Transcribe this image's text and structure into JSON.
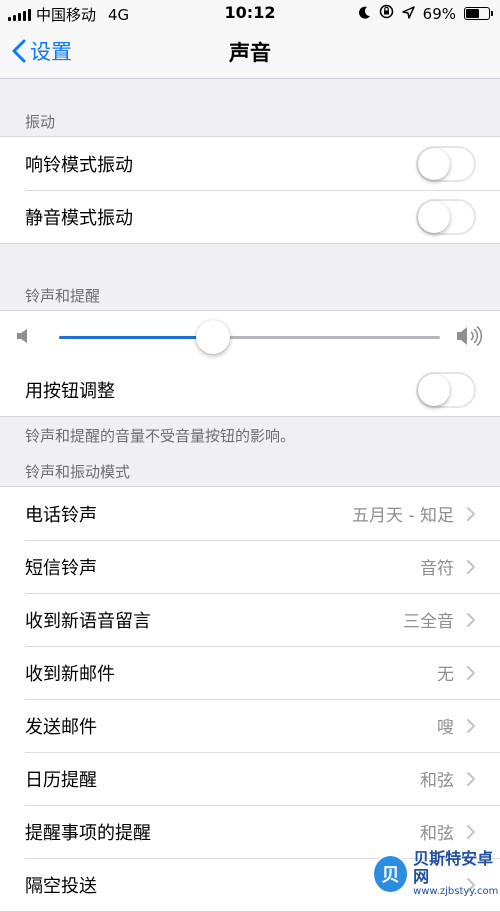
{
  "status_bar": {
    "carrier": "中国移动",
    "network": "4G",
    "time": "10:12",
    "battery_text": "69%",
    "battery_level": 0.69
  },
  "nav": {
    "back_label": "设置",
    "title": "声音"
  },
  "vibration": {
    "header": "振动",
    "items": [
      {
        "label": "响铃模式振动",
        "on": false
      },
      {
        "label": "静音模式振动",
        "on": false
      }
    ]
  },
  "ringer": {
    "header": "铃声和提醒",
    "volume_level": 0.405,
    "button_adjust": {
      "label": "用按钮调整",
      "on": false
    },
    "note": "铃声和提醒的音量不受音量按钮的影响。"
  },
  "patterns": {
    "header": "铃声和振动模式",
    "items": [
      {
        "label": "电话铃声",
        "value": "五月天 - 知足"
      },
      {
        "label": "短信铃声",
        "value": "音符"
      },
      {
        "label": "收到新语音留言",
        "value": "三全音"
      },
      {
        "label": "收到新邮件",
        "value": "无"
      },
      {
        "label": "发送邮件",
        "value": "嗖"
      },
      {
        "label": "日历提醒",
        "value": "和弦"
      },
      {
        "label": "提醒事项的提醒",
        "value": "和弦"
      },
      {
        "label": "隔空投送",
        "value": ""
      }
    ]
  },
  "watermark": {
    "logo_char": "贝",
    "name": "贝斯特安卓网",
    "url": "www.zjbstyy.com"
  },
  "colors": {
    "accent": "#0a7aff",
    "slider_fill": "#1e6fd6",
    "background": "#efeff4"
  }
}
